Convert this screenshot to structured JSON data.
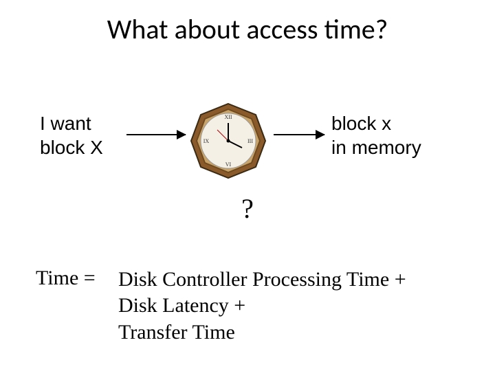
{
  "title": "What about access time?",
  "left_label": "I want\nblock X",
  "right_label": "block x\nin memory",
  "question_mark": "?",
  "equation": {
    "lhs": "Time =",
    "rhs": "Disk Controller Processing Time +\nDisk Latency +\nTransfer Time"
  }
}
